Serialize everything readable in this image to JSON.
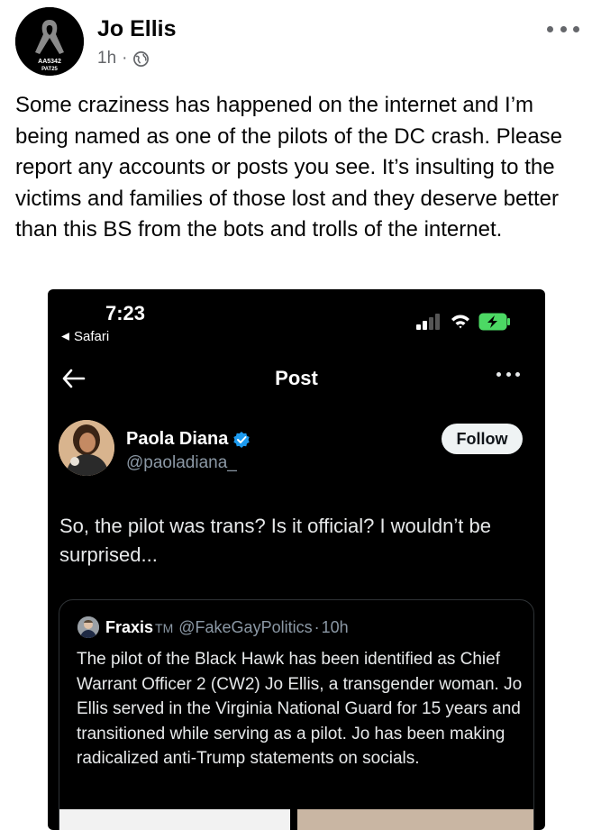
{
  "post": {
    "author": "Jo Ellis",
    "age": "1h",
    "separator": "·",
    "avatar_text_line1": "AA5342",
    "avatar_text_line2": "PAT25",
    "text": "Some craziness has happened on the internet and I’m being named as one of the pilots of the DC crash. Please report any accounts or posts you see. It’s insulting to the victims and families of those lost and they deserve better than this BS from the bots and trolls of the internet."
  },
  "screenshot": {
    "status_time": "7:23",
    "back_app": "Safari",
    "nav_title": "Post",
    "tweet": {
      "name": "Paola Diana",
      "handle": "@paoladiana_",
      "follow_label": "Follow",
      "text": "So, the pilot was trans? Is it official? I wouldn’t be surprised..."
    },
    "quoted": {
      "name": "Fraxis",
      "tm": "TM",
      "handle": "@FakeGayPolitics",
      "separator": "·",
      "age": "10h",
      "text": "The pilot of the Black Hawk has been identified as Chief Warrant Officer 2 (CW2) Jo Ellis, a transgender woman. Jo Ellis served in the Virginia National Guard for 15 years and transitioned while serving as a pilot. Jo has been making radicalized anti-Trump statements on socials."
    }
  },
  "icons": {
    "globe": "globe-icon",
    "more": "more-horizontal-icon",
    "verified": "verified-badge-icon",
    "battery": "battery-charging-icon",
    "wifi": "wifi-icon",
    "signal": "cell-signal-icon"
  },
  "colors": {
    "verified": "#1d9bf0",
    "battery": "#4cd964",
    "muted": "#65676b"
  }
}
